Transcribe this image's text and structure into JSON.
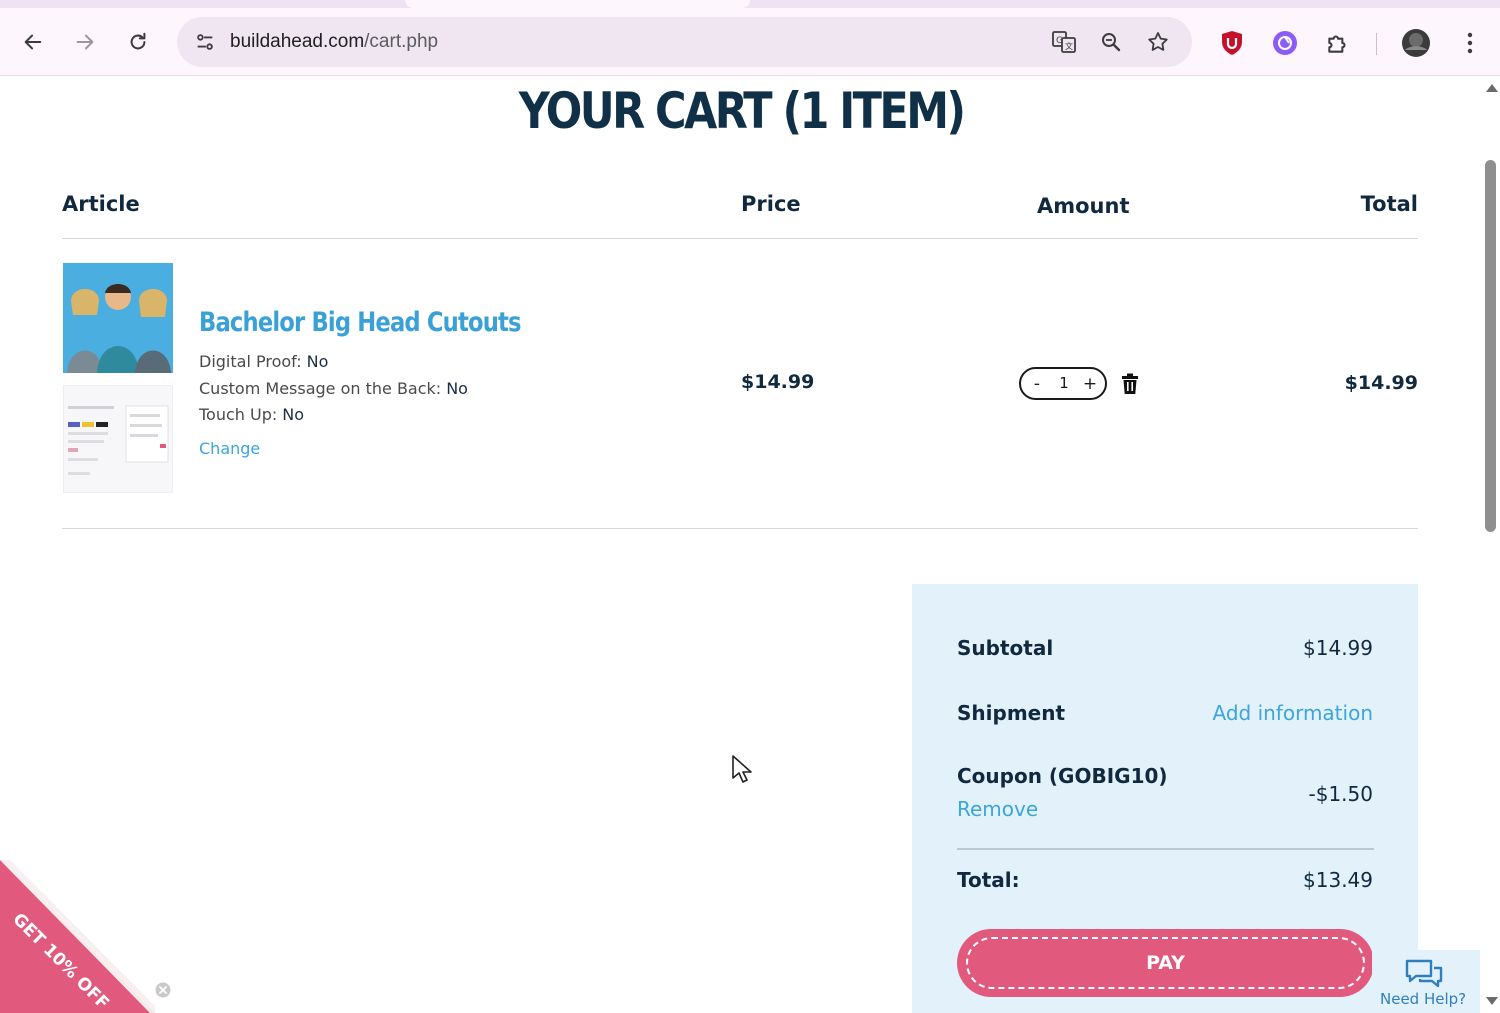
{
  "browser": {
    "url_host": "buildahead.com",
    "url_path": "/cart.php"
  },
  "page": {
    "title": "YOUR CART (1 ITEM)"
  },
  "table": {
    "headers": {
      "article": "Article",
      "price": "Price",
      "amount": "Amount",
      "total": "Total"
    }
  },
  "item": {
    "name": "Bachelor Big Head Cutouts",
    "options": [
      {
        "label": "Digital Proof:",
        "value": "No"
      },
      {
        "label": "Custom Message on the Back:",
        "value": "No"
      },
      {
        "label": "Touch Up:",
        "value": "No"
      }
    ],
    "change_label": "Change",
    "price": "$14.99",
    "quantity": "1",
    "qty_minus": "-",
    "qty_plus": "+",
    "line_total": "$14.99"
  },
  "summary": {
    "subtotal_label": "Subtotal",
    "subtotal_value": "$14.99",
    "shipment_label": "Shipment",
    "shipment_value": "Add information",
    "coupon_label": "Coupon (GOBIG10)",
    "coupon_remove": "Remove",
    "coupon_value": "-$1.50",
    "total_label": "Total:",
    "total_value": "$13.49",
    "pay_label": "PAY"
  },
  "help": {
    "label": "Need Help?"
  },
  "promo": {
    "label": "GET 10% OFF"
  },
  "colors": {
    "accent_blue": "#3aa0d8",
    "pay_pink": "#e15a7d",
    "summary_bg": "#e3f1fb",
    "heading_navy": "#0f3047"
  }
}
